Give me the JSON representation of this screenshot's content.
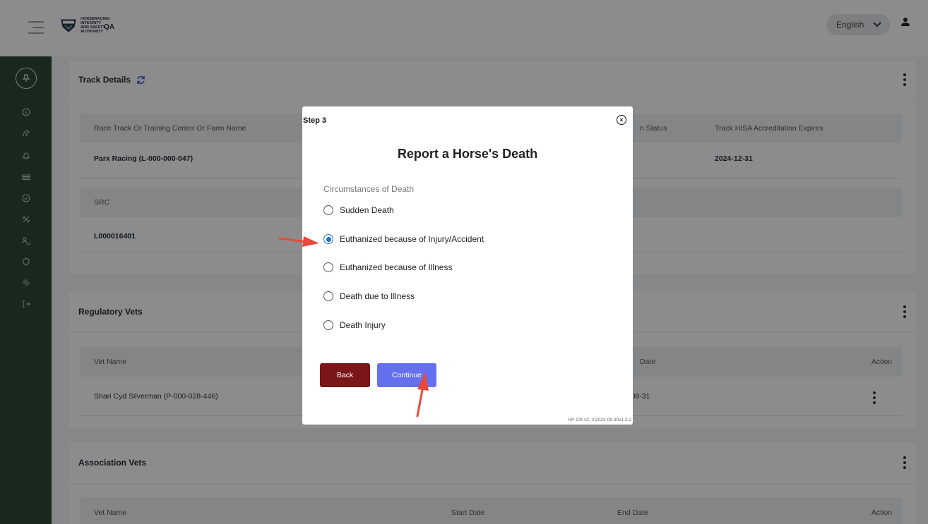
{
  "header": {
    "logo_lines": [
      "HORSERACING",
      "INTEGRITY",
      "AND SAFETY",
      "AUTHORITY"
    ],
    "environment": "QA",
    "language": "English",
    "icons": [
      "menu-icon",
      "hisa-logo",
      "chevron-down-icon",
      "user-icon"
    ]
  },
  "sidebar": {
    "icons": [
      "pin-icon",
      "info-icon",
      "horse-icon",
      "bell-icon",
      "cards-icon",
      "check-circle-icon",
      "tools-icon",
      "people-icon",
      "shield-icon",
      "settings-icon",
      "logout-icon"
    ]
  },
  "track_details": {
    "title": "Track Details",
    "columns": [
      "Race Track Or Training Center Or Farm Name",
      "n Status",
      "Track HISA Accreditation Expires"
    ],
    "values": [
      "Parx Racing (L-000-000-047)",
      "2024-12-31"
    ],
    "src_label": "SRC",
    "src_value": "L000016401"
  },
  "regulatory_vets": {
    "title": "Regulatory Vets",
    "columns": [
      "Vet Name",
      "Date",
      "Action"
    ],
    "rows": [
      {
        "name": "Shari Cyd Silverman (P-000-028-446)",
        "date": "-08-31"
      }
    ]
  },
  "association_vets": {
    "title": "Association Vets",
    "columns": [
      "Vet Name",
      "Start Date",
      "End Date",
      "Action"
    ]
  },
  "modal": {
    "step": "Step 3",
    "close_symbol": "×",
    "title": "Report a Horse's Death",
    "section_label": "Circumstances of Death",
    "options": [
      {
        "label": "Sudden Death",
        "checked": false
      },
      {
        "label": "Euthanized because of Injury/Accident",
        "checked": true
      },
      {
        "label": "Euthanized because of Illness",
        "checked": false
      },
      {
        "label": "Death due to Illness",
        "checked": false
      },
      {
        "label": "Death Injury",
        "checked": false
      }
    ],
    "back_label": "Back",
    "continue_label": "Continue",
    "version": "HP-CR-v2, V.2023-09-30v1.3.2"
  },
  "colors": {
    "sidebar": "#2d4a35",
    "back_button": "#7a1519",
    "continue_button": "#6470f0",
    "radio_selected": "#1a73c8",
    "annotation_arrow": "#e8493a"
  }
}
